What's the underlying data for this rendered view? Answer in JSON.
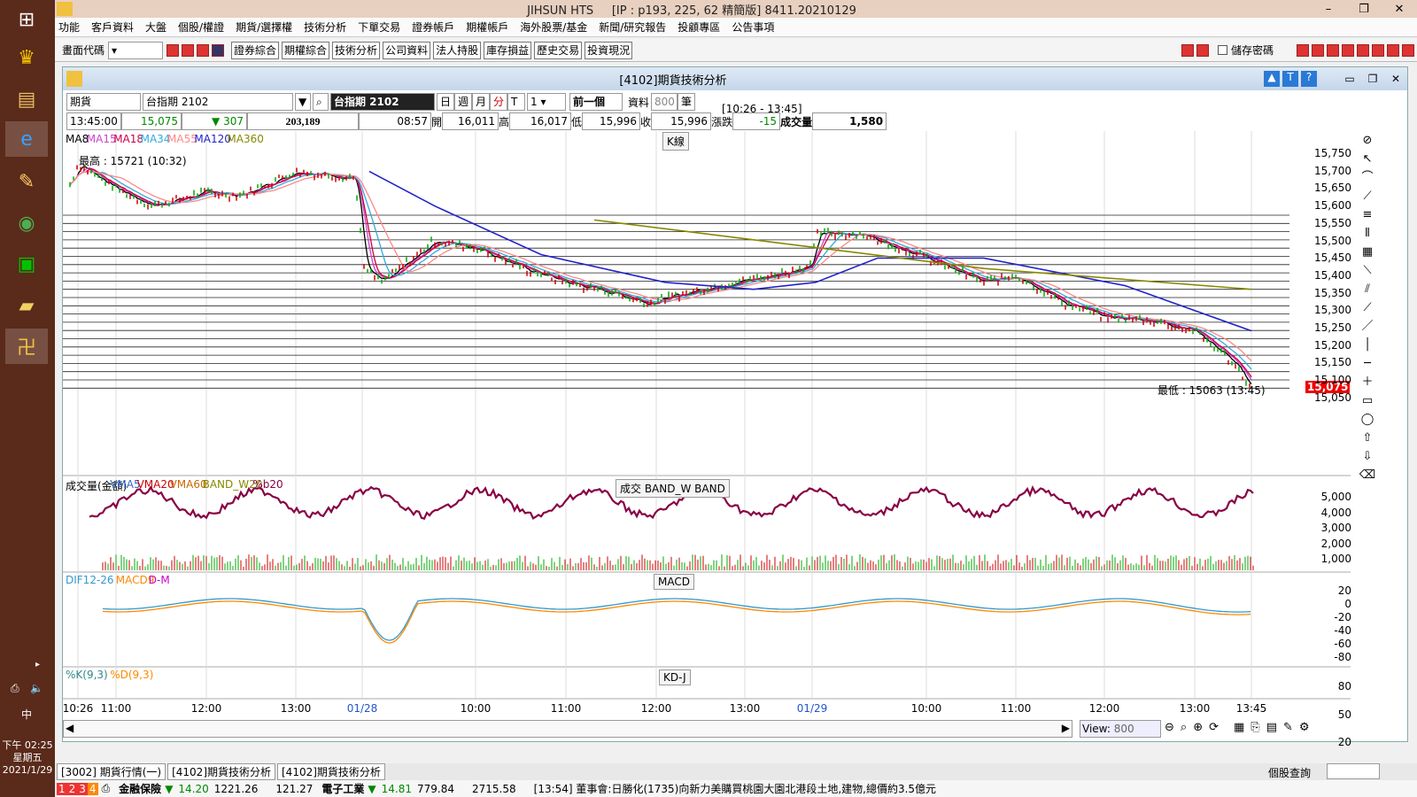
{
  "titlebar": {
    "title": "JIHSUN HTS",
    "ip": "[IP : p193, 225, 62 精簡版] 8411.20210129"
  },
  "menu": [
    "功能",
    "客戶資料",
    "大盤",
    "個股/權證",
    "期貨/選擇權",
    "技術分析",
    "下單交易",
    "證券帳戶",
    "期權帳戶",
    "海外股票/基金",
    "新聞/研究報告",
    "投顧專區",
    "公告事項"
  ],
  "toolbar": {
    "code_label": "畫面代碼",
    "buttons": [
      "證券綜合",
      "期權綜合",
      "技術分析",
      "公司資料",
      "法人持股",
      "庫存損益",
      "歷史交易",
      "投資現況"
    ],
    "save_pw": "儲存密碼"
  },
  "inner": {
    "title": "[4102]期貨技術分析"
  },
  "controls": {
    "type": "期貨",
    "symbol": "台指期 2102",
    "symbol_dark": "台指期 2102",
    "day": "日",
    "week": "週",
    "month": "月",
    "min": "分",
    "tick": "T",
    "interval": "1",
    "prev": "前一個",
    "data_label": "資料",
    "data_count": "800",
    "unit": "筆",
    "range": "[10:26 - 13:45]"
  },
  "quote": {
    "time": "13:45:00",
    "last": "15,075",
    "change": "307",
    "volume_total": "203,189",
    "open_time": "08:57",
    "open_label": "開",
    "open": "16,011",
    "high_label": "高",
    "high": "16,017",
    "low_label": "低",
    "low": "15,996",
    "close_label": "收",
    "close": "15,996",
    "chg_label": "漲跌",
    "chg": "-15",
    "vol_label": "成交量",
    "vol": "1,580"
  },
  "kline": {
    "legend": [
      {
        "name": "MA8",
        "color": "#000000"
      },
      {
        "name": "MA15",
        "color": "#cc44cc"
      },
      {
        "name": "MA18",
        "color": "#cc0044"
      },
      {
        "name": "MA34",
        "color": "#33aadd"
      },
      {
        "name": "MA55",
        "color": "#ff8888"
      },
      {
        "name": "MA120",
        "color": "#2222cc"
      },
      {
        "name": "MA360",
        "color": "#888800"
      }
    ],
    "tag": "K線",
    "high_note": "最高 : 15721 (10:32)",
    "low_note": "最低 : 15063 (13:45)",
    "last_badge": "15,075",
    "yticks": [
      "15,750",
      "15,700",
      "15,650",
      "15,600",
      "15,550",
      "15,500",
      "15,450",
      "15,400",
      "15,350",
      "15,300",
      "15,250",
      "15,200",
      "15,150",
      "15,100",
      "15,050"
    ]
  },
  "volume": {
    "legend": [
      {
        "name": "成交量(金額)",
        "color": "#000000"
      },
      {
        "name": "VMA5",
        "color": "#3366cc"
      },
      {
        "name": "VMA20",
        "color": "#cc0000"
      },
      {
        "name": "VMA60",
        "color": "#cc6600"
      },
      {
        "name": "BAND_W20",
        "color": "#888800"
      },
      {
        "name": "%b20",
        "color": "#880044"
      }
    ],
    "tag1": "成交",
    "tag2": "BAND_W",
    "tag3": "BAND",
    "yticks": [
      "5,000",
      "4,000",
      "3,000",
      "2,000",
      "1,000"
    ]
  },
  "macd": {
    "legend": [
      {
        "name": "DIF12-26",
        "color": "#3399cc"
      },
      {
        "name": "MACD9",
        "color": "#ff8800"
      },
      {
        "name": "D-M",
        "color": "#cc00cc"
      }
    ],
    "tag": "MACD",
    "yticks": [
      "20",
      "0",
      "-20",
      "-40",
      "-60",
      "-80"
    ]
  },
  "kd": {
    "legend": [
      {
        "name": "%K(9,3)",
        "color": "#338888"
      },
      {
        "name": "%D(9,3)",
        "color": "#ff8800"
      }
    ],
    "tag": "KD-J",
    "yticks": [
      "80",
      "50",
      "20"
    ]
  },
  "xaxis": [
    "10:26",
    "11:00",
    "12:00",
    "13:00",
    "01/28",
    "10:00",
    "11:00",
    "12:00",
    "13:00",
    "01/29",
    "10:00",
    "11:00",
    "12:00",
    "13:00",
    "13:45"
  ],
  "view": {
    "label": "View:",
    "value": "800"
  },
  "tabs": [
    "[3002] 期貨行情(一)",
    "[4102]期貨技術分析",
    "[4102]期貨技術分析"
  ],
  "stock_query": "個股查詢",
  "ticker": {
    "item1": "金融保險",
    "v1a": "14.20",
    "v1b": "1221.26",
    "v1c": "121.27",
    "item2": "電子工業",
    "v2a": "14.81",
    "v2b": "779.84",
    "v2c": "2715.58",
    "news": "[13:54] 董事會:日勝化(1735)向新力美購買桃園大園北港段土地,建物,總價約3.5億元"
  },
  "clock": {
    "time": "下午 02:25",
    "weekday": "星期五",
    "date": "2021/1/29"
  },
  "input_method": "中"
}
